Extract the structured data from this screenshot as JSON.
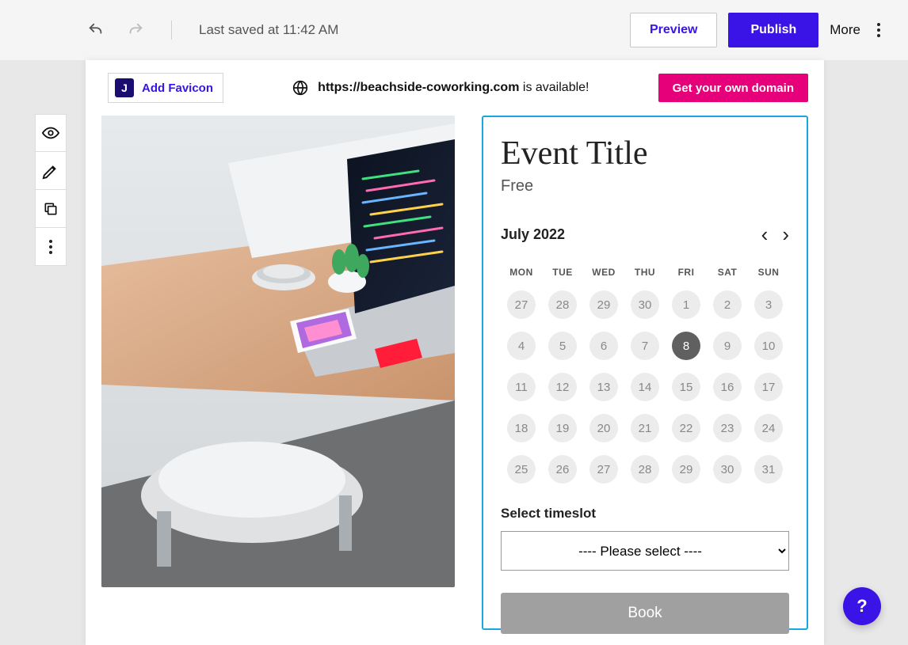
{
  "topbar": {
    "saved_text": "Last saved at 11:42 AM",
    "preview_label": "Preview",
    "publish_label": "Publish",
    "more_label": "More"
  },
  "domain_bar": {
    "favicon_label": "Add Favicon",
    "favicon_letter": "J",
    "url": "https://beachside-coworking.com",
    "availability_text": " is available!",
    "get_domain_label": "Get your own domain"
  },
  "booking": {
    "event_title": "Event Title",
    "price": "Free",
    "month_label": "July 2022",
    "dow": [
      "MON",
      "TUE",
      "WED",
      "THU",
      "FRI",
      "SAT",
      "SUN"
    ],
    "days": [
      {
        "d": "27"
      },
      {
        "d": "28"
      },
      {
        "d": "29"
      },
      {
        "d": "30"
      },
      {
        "d": "1"
      },
      {
        "d": "2"
      },
      {
        "d": "3"
      },
      {
        "d": "4"
      },
      {
        "d": "5"
      },
      {
        "d": "6"
      },
      {
        "d": "7"
      },
      {
        "d": "8",
        "selected": true
      },
      {
        "d": "9"
      },
      {
        "d": "10"
      },
      {
        "d": "11"
      },
      {
        "d": "12"
      },
      {
        "d": "13"
      },
      {
        "d": "14"
      },
      {
        "d": "15"
      },
      {
        "d": "16"
      },
      {
        "d": "17"
      },
      {
        "d": "18"
      },
      {
        "d": "19"
      },
      {
        "d": "20"
      },
      {
        "d": "21"
      },
      {
        "d": "22"
      },
      {
        "d": "23"
      },
      {
        "d": "24"
      },
      {
        "d": "25"
      },
      {
        "d": "26"
      },
      {
        "d": "27"
      },
      {
        "d": "28"
      },
      {
        "d": "29"
      },
      {
        "d": "30"
      },
      {
        "d": "31"
      }
    ],
    "timeslot_label": "Select timeslot",
    "timeslot_placeholder": "---- Please select ----",
    "book_label": "Book"
  },
  "help": {
    "label": "?"
  },
  "nav_symbols": {
    "prev": "‹",
    "next": "›"
  }
}
